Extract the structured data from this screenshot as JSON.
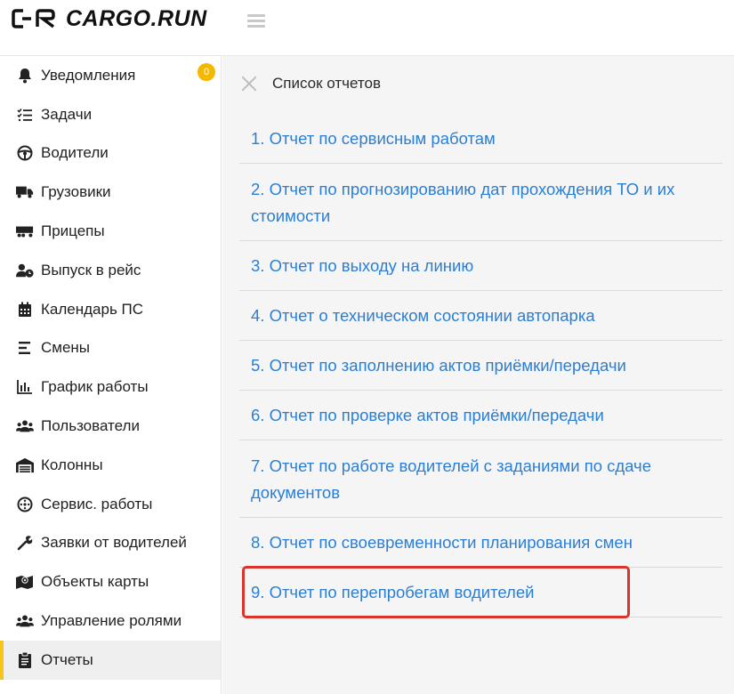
{
  "app": {
    "logo_text": "CARGO.RUN"
  },
  "sidebar": {
    "items": [
      {
        "label": "Уведомления",
        "icon": "bell-icon",
        "badge": "0"
      },
      {
        "label": "Задачи",
        "icon": "tasks-icon"
      },
      {
        "label": "Водители",
        "icon": "steering-wheel-icon"
      },
      {
        "label": "Грузовики",
        "icon": "truck-icon"
      },
      {
        "label": "Прицепы",
        "icon": "trailer-icon"
      },
      {
        "label": "Выпуск в рейс",
        "icon": "user-clock-icon"
      },
      {
        "label": "Календарь ПС",
        "icon": "calendar-icon"
      },
      {
        "label": "Смены",
        "icon": "shifts-icon"
      },
      {
        "label": "График работы",
        "icon": "chart-icon"
      },
      {
        "label": "Пользователи",
        "icon": "users-icon"
      },
      {
        "label": "Колонны",
        "icon": "garage-icon"
      },
      {
        "label": "Сервис. работы",
        "icon": "wheel-icon"
      },
      {
        "label": "Заявки от водителей",
        "icon": "wrench-icon"
      },
      {
        "label": "Объекты карты",
        "icon": "map-icon"
      },
      {
        "label": "Управление ролями",
        "icon": "roles-icon"
      },
      {
        "label": "Отчеты",
        "icon": "clipboard-icon",
        "active": true
      }
    ]
  },
  "main": {
    "title": "Список отчетов",
    "reports": [
      "1. Отчет по сервисным работам",
      "2. Отчет по прогнозированию дат прохождения ТО и их стоимости",
      "3. Отчет по выходу на линию",
      "4. Отчет о техническом состоянии автопарка",
      "5. Отчет по заполнению актов приёмки/передачи",
      "6. Отчет по проверке актов приёмки/передачи",
      "7. Отчет по работе водителей с заданиями по сдаче документов",
      "8. Отчет по своевременности планирования смен",
      "9. Отчет по перепробегам водителей"
    ]
  },
  "colors": {
    "accent": "#f5c518",
    "link": "#2a7fd4",
    "highlight": "#d9342b",
    "badge": "#f5b800"
  }
}
